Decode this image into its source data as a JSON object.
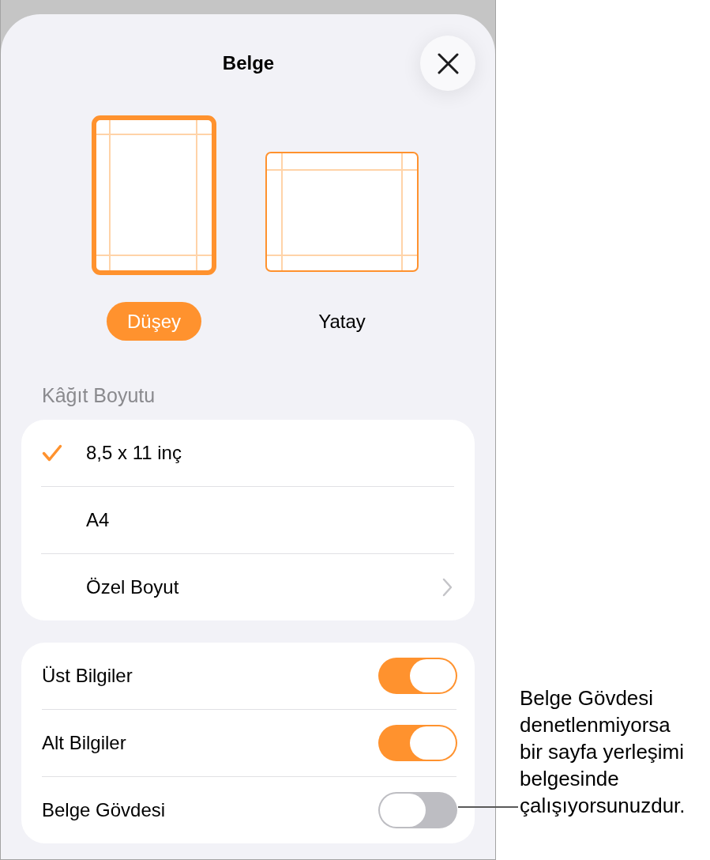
{
  "sheet": {
    "title": "Belge"
  },
  "orientations": [
    {
      "kind": "portrait",
      "label": "Düşey",
      "selected": true
    },
    {
      "kind": "landscape",
      "label": "Yatay",
      "selected": false
    }
  ],
  "paper_size": {
    "header": "Kâğıt Boyutu",
    "options": [
      {
        "kind": "choice",
        "label": "8,5 x 11 inç",
        "selected": true
      },
      {
        "kind": "choice",
        "label": "A4",
        "selected": false
      },
      {
        "kind": "submenu",
        "label": "Özel Boyut",
        "selected": false
      }
    ]
  },
  "toggles": [
    {
      "label": "Üst Bilgiler",
      "on": true
    },
    {
      "label": "Alt Bilgiler",
      "on": true
    },
    {
      "label": "Belge Gövdesi",
      "on": false
    }
  ],
  "callout": {
    "text": "Belge Gövdesi denetlenmiyorsa bir sayfa yerleşimi belgesinde çalışıyorsunuzdur."
  }
}
